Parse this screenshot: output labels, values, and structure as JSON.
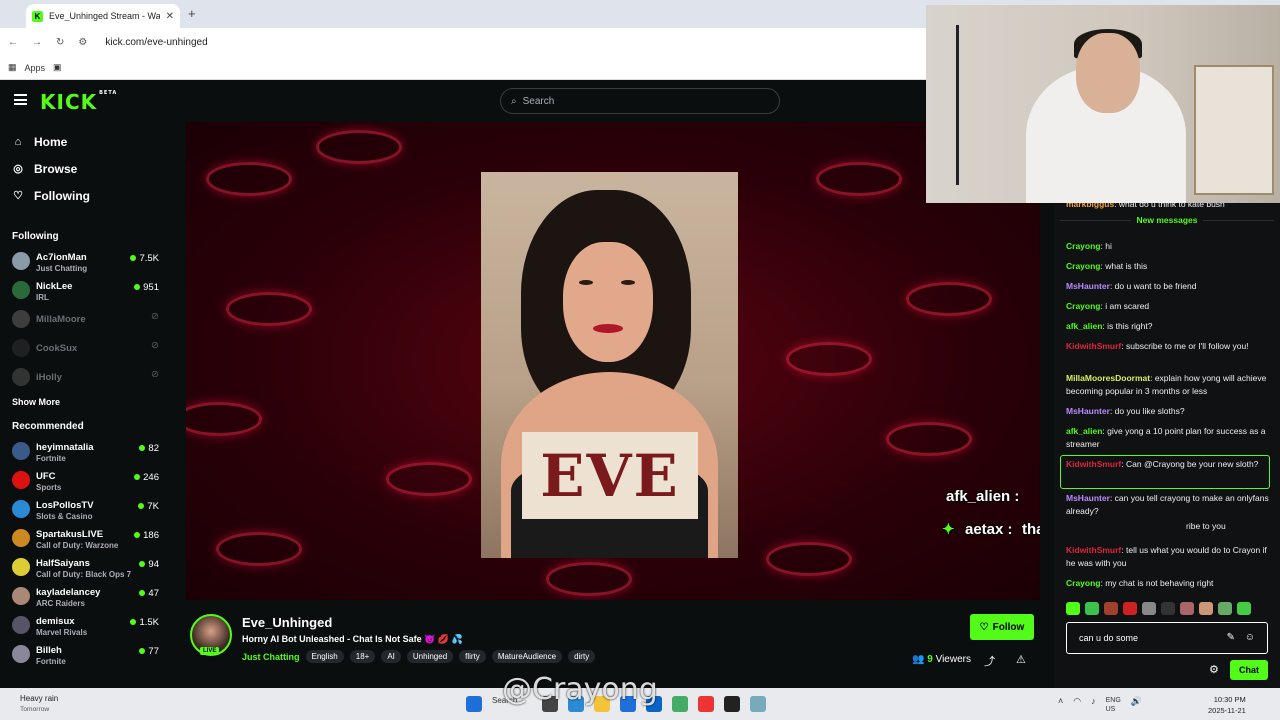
{
  "browser": {
    "tab_title": "Eve_Unhinged Stream - Watch Live",
    "url": "kick.com/eve-unhinged",
    "bookmarks_label": "Apps"
  },
  "header": {
    "logo": "KICK",
    "logo_badge": "BETA",
    "search_placeholder": "Search"
  },
  "sidebar": {
    "nav": [
      {
        "label": "Home",
        "icon": "home-icon"
      },
      {
        "label": "Browse",
        "icon": "compass-icon"
      },
      {
        "label": "Following",
        "icon": "heart-icon"
      }
    ],
    "following_title": "Following",
    "following": [
      {
        "name": "Ac7ionMan",
        "category": "Just Chatting",
        "viewers": "7.5K",
        "color": "#8a9aa8"
      },
      {
        "name": "NickLee",
        "category": "IRL",
        "viewers": "951",
        "color": "#2a6a3a"
      },
      {
        "name": "MillaMoore",
        "category": "",
        "viewers": "",
        "color": "#999"
      },
      {
        "name": "CookSux",
        "category": "",
        "viewers": "",
        "color": "#444"
      },
      {
        "name": "iHolly",
        "category": "",
        "viewers": "",
        "color": "#777"
      }
    ],
    "show_more": "Show More",
    "recommended_title": "Recommended",
    "recommended": [
      {
        "name": "heyimnatalia",
        "category": "Fortnite",
        "viewers": "82",
        "color": "#3a5a8a"
      },
      {
        "name": "UFC",
        "category": "Sports",
        "viewers": "246",
        "color": "#d11"
      },
      {
        "name": "LosPollosTV",
        "category": "Slots & Casino",
        "viewers": "7K",
        "color": "#2a8ad4"
      },
      {
        "name": "SpartakusLIVE",
        "category": "Call of Duty: Warzone",
        "viewers": "186",
        "color": "#c82"
      },
      {
        "name": "HalfSaiyans",
        "category": "Call of Duty: Black Ops 7",
        "viewers": "94",
        "color": "#dc3"
      },
      {
        "name": "kayladelancey",
        "category": "ARC Raiders",
        "viewers": "47",
        "color": "#a87"
      },
      {
        "name": "demisux",
        "category": "Marvel Rivals",
        "viewers": "1.5K",
        "color": "#556"
      },
      {
        "name": "Billeh",
        "category": "Fortnite",
        "viewers": "77",
        "color": "#889"
      }
    ]
  },
  "player": {
    "sign_text": "EVE",
    "overlay_user1": "afk_alien :",
    "overlay_user2": "aetax :",
    "overlay_msg2": "that was great content"
  },
  "stream": {
    "username": "Eve_Unhinged",
    "live": "LIVE",
    "title": "Horny AI Bot Unleashed - Chat Is Not Safe 👿 💋 💦",
    "category": "Just Chatting",
    "tags": [
      "English",
      "18+",
      "AI",
      "Unhinged",
      "flirty",
      "MatureAudience",
      "dirty"
    ],
    "follow_label": "Follow",
    "viewers_count": "9",
    "viewers_label": "Viewers"
  },
  "chat": {
    "prev_user": "markbiggus",
    "prev_text": "what do u think to kate bush",
    "new_messages_label": "New messages",
    "messages": [
      {
        "user": "Crayong",
        "color": "#53fc18",
        "text": "hi"
      },
      {
        "user": "Crayong",
        "color": "#53fc18",
        "text": "what is this"
      },
      {
        "user": "MsHaunter",
        "color": "#b98bff",
        "text": "do u want to be friend"
      },
      {
        "user": "Crayong",
        "color": "#53fc18",
        "text": "i am scared"
      },
      {
        "user": "afk_alien",
        "color": "#53fc18",
        "text": "is this right?"
      },
      {
        "user": "KidwithSmurf",
        "color": "#e0233d",
        "text": "subscribe to me or I'll follow you!"
      },
      {
        "user": "MillaMooresDoormat",
        "color": "#d7f25a",
        "text": "explain how yong will achieve becoming popular in 3 months or less"
      },
      {
        "user": "MsHaunter",
        "color": "#b98bff",
        "text": "do you like sloths?"
      },
      {
        "user": "afk_alien",
        "color": "#53fc18",
        "text": "give yong a 10 point plan for success as a streamer"
      },
      {
        "user": "KidwithSmurf",
        "color": "#e0233d",
        "text": "Can @Crayong be your new sloth?"
      },
      {
        "user": "MsHaunter",
        "color": "#b98bff",
        "text": "can you tell crayong to make an onlyfans already?"
      },
      {
        "user": "",
        "color": "#efeff1",
        "text": "ribe to you"
      },
      {
        "user": "KidwithSmurf",
        "color": "#e0233d",
        "text": "tell us what you would do to Crayon if he was with you"
      },
      {
        "user": "Crayong",
        "color": "#53fc18",
        "text": "my chat is not behaving right"
      }
    ],
    "input_value": "can u do some",
    "send_label": "Chat"
  },
  "taskbar": {
    "weather_title": "Heavy rain",
    "weather_sub": "Tomorrow",
    "search_label": "Search",
    "lang": "ENG",
    "region": "US",
    "time": "10:30 PM",
    "date": "2025-11-21"
  },
  "watermark": "@Crayong"
}
